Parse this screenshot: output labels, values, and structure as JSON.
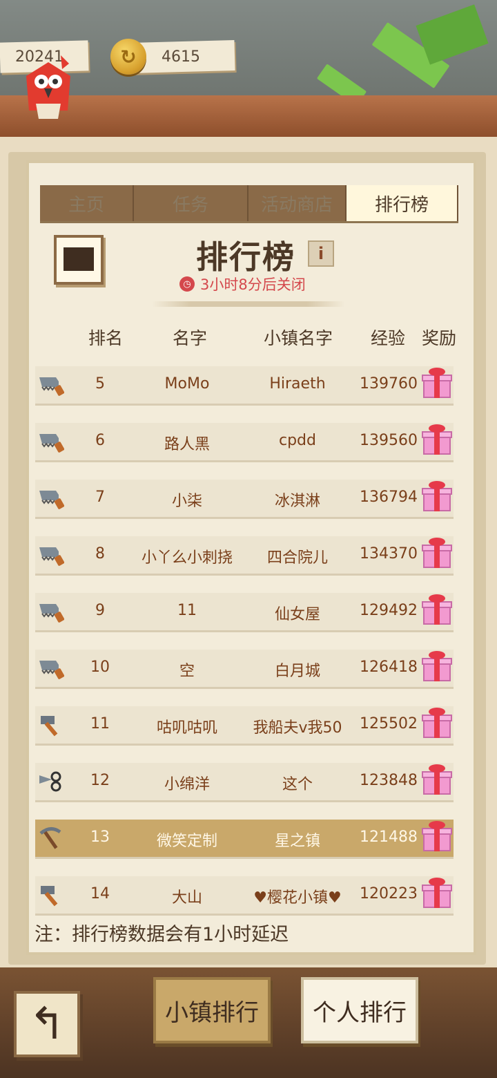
{
  "currency": {
    "gems": "20241",
    "coins": "4615"
  },
  "tabs": [
    {
      "label": "主页",
      "active": false
    },
    {
      "label": "任务",
      "active": false
    },
    {
      "label": "活动商店",
      "active": false
    },
    {
      "label": "排行榜",
      "active": true
    }
  ],
  "header": {
    "title": "排行榜",
    "info": "i",
    "timer": "3小时8分后关闭"
  },
  "columns": {
    "rank": "排名",
    "name": "名字",
    "town": "小镇名字",
    "exp": "经验",
    "reward": "奖励"
  },
  "rows": [
    {
      "rank": "5",
      "name": "MoMo",
      "town": "Hiraeth",
      "exp": "139760",
      "tool": "saw-icon"
    },
    {
      "rank": "6",
      "name": "路人黑",
      "town": "cpdd",
      "exp": "139560",
      "tool": "saw-icon"
    },
    {
      "rank": "7",
      "name": "小柒",
      "town": "冰淇淋",
      "exp": "136794",
      "tool": "saw-icon"
    },
    {
      "rank": "8",
      "name": "小丫么小刺挠",
      "town": "四合院儿",
      "exp": "134370",
      "tool": "saw-icon"
    },
    {
      "rank": "9",
      "name": "11",
      "town": "仙女屋",
      "exp": "129492",
      "tool": "saw-icon"
    },
    {
      "rank": "10",
      "name": "空",
      "town": "白月城",
      "exp": "126418",
      "tool": "saw-icon"
    },
    {
      "rank": "11",
      "name": "咕叽咕叽",
      "town": "我船夫v我50",
      "exp": "125502",
      "tool": "hammer-icon"
    },
    {
      "rank": "12",
      "name": "小绵洋",
      "town": "这个",
      "exp": "123848",
      "tool": "shears-icon"
    },
    {
      "rank": "13",
      "name": "微笑定制",
      "town": "星之镇",
      "exp": "121488",
      "tool": "pickaxe-icon",
      "highlight": true
    },
    {
      "rank": "14",
      "name": "大山",
      "town": "♥樱花小镇♥",
      "exp": "120223",
      "tool": "hammer-icon"
    }
  ],
  "note": "注：排行榜数据会有1小时延迟",
  "buttons": {
    "town_rank": "小镇排行",
    "personal_rank": "个人排行"
  },
  "colors": {
    "highlight_row": "#c9a86a",
    "panel": "#f3ecda",
    "text_brown": "#7a3f1a",
    "timer_red": "#d4484c"
  }
}
